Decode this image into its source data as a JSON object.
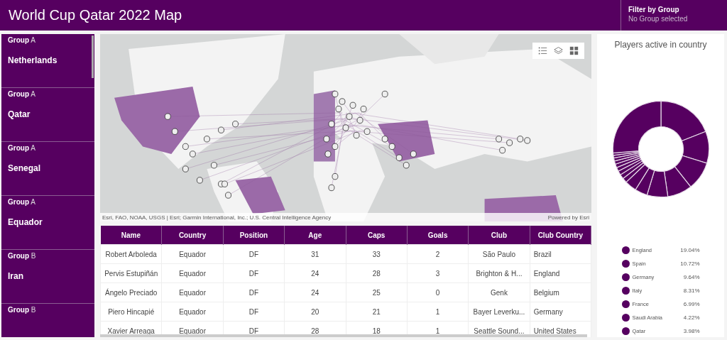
{
  "header": {
    "title": "World Cup Qatar 2022 Map",
    "filter_label": "Filter by Group",
    "filter_value": "No Group selected"
  },
  "sidebar": {
    "items": [
      {
        "group_label": "Group",
        "group": "A",
        "team": "Netherlands"
      },
      {
        "group_label": "Group",
        "group": "A",
        "team": "Qatar"
      },
      {
        "group_label": "Group",
        "group": "A",
        "team": "Senegal"
      },
      {
        "group_label": "Group",
        "group": "A",
        "team": "Equador"
      },
      {
        "group_label": "Group",
        "group": "B",
        "team": "Iran"
      },
      {
        "group_label": "Group",
        "group": "B"
      }
    ]
  },
  "map": {
    "attribution": "Esri, FAO, NOAA, USGS | Esri; Garmin International, Inc.; U.S. Central Intelligence Agency",
    "powered_by": "Powered by Esri"
  },
  "table": {
    "columns": [
      "Name",
      "Country",
      "Position",
      "Age",
      "Caps",
      "Goals",
      "Club",
      "Club Country"
    ],
    "rows": [
      [
        "Robert Arboleda",
        "Equador",
        "DF",
        "31",
        "33",
        "2",
        "São Paulo",
        "Brazil"
      ],
      [
        "Pervis Estupiñán",
        "Equador",
        "DF",
        "24",
        "28",
        "3",
        "Brighton & H...",
        "England"
      ],
      [
        "Ángelo Preciado",
        "Equador",
        "DF",
        "24",
        "25",
        "0",
        "Genk",
        "Belgium"
      ],
      [
        "Piero Hincapié",
        "Equador",
        "DF",
        "20",
        "21",
        "1",
        "Bayer Leverku...",
        "Germany"
      ],
      [
        "Xavier Arreaga",
        "Equador",
        "DF",
        "28",
        "18",
        "1",
        "Seattle Sound...",
        "United States"
      ]
    ]
  },
  "chart_panel": {
    "title": "Players active in country",
    "legend": [
      {
        "country": "England",
        "share": "19.04%"
      },
      {
        "country": "Spain",
        "share": "10.72%"
      },
      {
        "country": "Germany",
        "share": "9.64%"
      },
      {
        "country": "Italy",
        "share": "8.31%"
      },
      {
        "country": "France",
        "share": "6.99%"
      },
      {
        "country": "Saudi Arabia",
        "share": "4.22%"
      },
      {
        "country": "Qatar",
        "share": "3.98%"
      }
    ]
  }
}
